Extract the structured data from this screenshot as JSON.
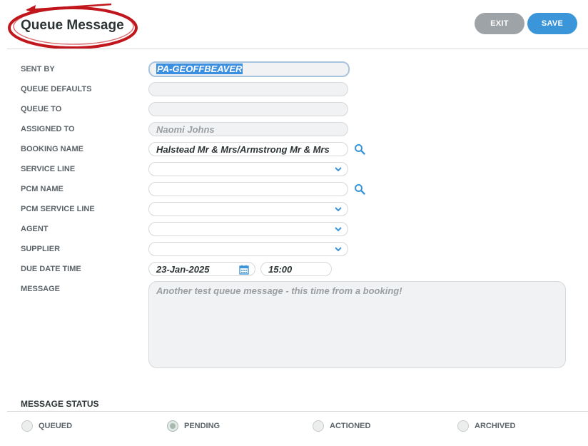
{
  "header": {
    "title": "Queue Message",
    "exit_label": "EXIT",
    "save_label": "SAVE"
  },
  "form": {
    "sent_by": {
      "label": "SENT BY",
      "value": "PA-GEOFFBEAVER"
    },
    "queue_defaults": {
      "label": "QUEUE DEFAULTS",
      "value": ""
    },
    "queue_to": {
      "label": "QUEUE TO",
      "value": ""
    },
    "assigned_to": {
      "label": "ASSIGNED TO",
      "value": "Naomi Johns"
    },
    "booking_name": {
      "label": "BOOKING NAME",
      "value": "Halstead Mr & Mrs/Armstrong Mr & Mrs"
    },
    "service_line": {
      "label": "SERVICE LINE",
      "value": ""
    },
    "pcm_name": {
      "label": "PCM NAME",
      "value": ""
    },
    "pcm_service_line": {
      "label": "PCM SERVICE LINE",
      "value": ""
    },
    "agent": {
      "label": "AGENT",
      "value": ""
    },
    "supplier": {
      "label": "SUPPLIER",
      "value": ""
    },
    "due_date_time": {
      "label": "DUE DATE TIME",
      "date": "23-Jan-2025",
      "time": "15:00"
    },
    "message": {
      "label": "MESSAGE",
      "value": "Another test queue message - this time from a booking!"
    }
  },
  "status": {
    "title": "MESSAGE STATUS",
    "options": [
      {
        "label": "QUEUED",
        "selected": false
      },
      {
        "label": "PENDING",
        "selected": true
      },
      {
        "label": "ACTIONED",
        "selected": false
      },
      {
        "label": "ARCHIVED",
        "selected": false
      }
    ]
  },
  "colors": {
    "accent": "#3b95d9",
    "exit_button": "#9ea3a7",
    "annotation_ring": "#c0161c"
  }
}
